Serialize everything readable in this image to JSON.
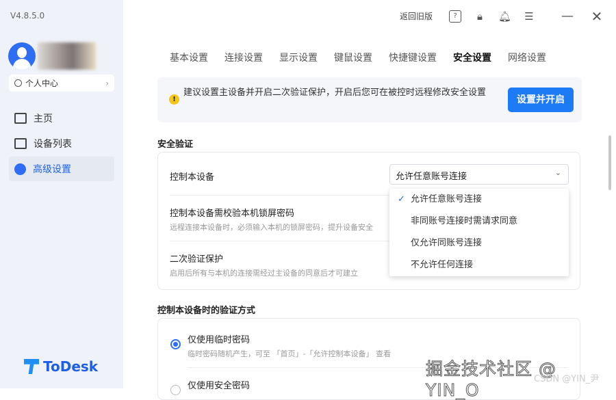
{
  "app": {
    "version": "V4.8.5.0",
    "logo_text": "ToDesk"
  },
  "sidebar": {
    "personal_center": "个人中心",
    "items": [
      {
        "label": "主页"
      },
      {
        "label": "设备列表"
      },
      {
        "label": "高级设置"
      }
    ]
  },
  "topbar": {
    "back_old": "返回旧版"
  },
  "tabs": [
    "基本设置",
    "连接设置",
    "显示设置",
    "键鼠设置",
    "快捷键设置",
    "安全设置",
    "网络设置"
  ],
  "banner": {
    "text": "建议设置主设备并开启二次验证保护，开启后您可在被控时远程修改安全设置",
    "button": "设置并开启"
  },
  "security": {
    "title": "安全验证",
    "control_label": "控制本设备",
    "control_value": "允许任意账号连接",
    "options": [
      "允许任意账号连接",
      "非同账号连接时需请求同意",
      "仅允许同账号连接",
      "不允许任何连接"
    ],
    "lock_title": "控制本设备需校验本机锁屏密码",
    "lock_desc": "远程连接本设备时，必须输入本机的锁屏密码，提升设备安全",
    "twofa_title": "二次验证保护",
    "twofa_desc": "启用后所有与本机的连接需经过主设备的同意后才可建立"
  },
  "verify": {
    "title": "控制本设备时的验证方式",
    "opt1": "仅使用临时密码",
    "opt1_desc": "临时密码随机产生，可至 「首页」-「允许控制本设备」 查看",
    "opt2": "仅使用安全密码"
  },
  "watermark": {
    "juejin": "掘金技术社区 @ YIN_O",
    "csdn": "CSDN @YIN_尹"
  }
}
